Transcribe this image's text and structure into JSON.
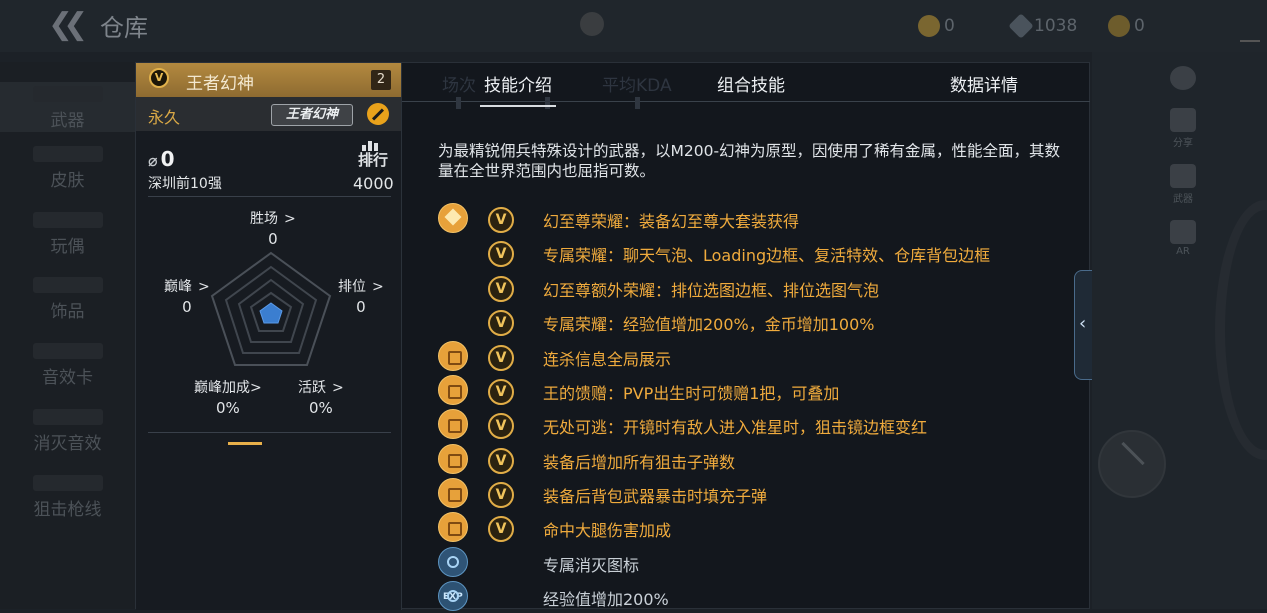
{
  "header": {
    "title": "仓库",
    "currencies": [
      {
        "icon": "gold-coin-icon",
        "value": "0"
      },
      {
        "icon": "diamond-icon",
        "value": "1038"
      },
      {
        "icon": "coupon-icon",
        "value": "0"
      }
    ]
  },
  "sidebar": {
    "items": [
      {
        "label": "武器"
      },
      {
        "label": "皮肤"
      },
      {
        "label": "玩偶"
      },
      {
        "label": "饰品"
      },
      {
        "label": "音效卡"
      },
      {
        "label": "消灭音效"
      },
      {
        "label": "狙击枪线"
      }
    ]
  },
  "right_toolbar": {
    "share_label": "分享",
    "weapon_label": "武器",
    "ar_label": "AR"
  },
  "popup": {
    "item_name": "王者幻神",
    "badge_letter": "V",
    "item_count": "2",
    "duration": "永久",
    "logo_text": "王者幻神",
    "kills": "0",
    "region_rank": "深圳前10强",
    "rank_label": "排行",
    "rank_value": "4000",
    "stats": {
      "wins_label": "胜场",
      "wins_value": "0",
      "peak_label": "巅峰",
      "peak_value": "0",
      "ranked_label": "排位",
      "ranked_value": "0",
      "peak_bonus_label": "巅峰加成",
      "peak_bonus_value": "0%",
      "activity_label": "活跃",
      "activity_value": "0%"
    },
    "ghost_tabs": [
      "场次",
      "",
      "平均KDA"
    ],
    "tabs": [
      {
        "label": "技能介绍",
        "active": true
      },
      {
        "label": "组合技能",
        "active": false
      },
      {
        "label": "数据详情",
        "active": false
      }
    ],
    "description": "为最精锐佣兵特殊设计的武器，以M200-幻神为原型，因使用了稀有金属，性能全面，其数量在全世界范围内也屈指可数。",
    "skills": [
      {
        "icon": "diamond-honor-icon",
        "text": "幻至尊荣耀：装备幻至尊大套装获得",
        "color": "orange"
      },
      {
        "icon": "",
        "text": "专属荣耀：聊天气泡、Loading边框、复活特效、仓库背包边框",
        "color": "orange"
      },
      {
        "icon": "",
        "text": "幻至尊额外荣耀：排位选图边框、排位选图气泡",
        "color": "orange"
      },
      {
        "icon": "",
        "text": "专属荣耀：经验值增加200%，金币增加100%",
        "color": "orange"
      },
      {
        "icon": "kill-banner-icon",
        "text": "连杀信息全局展示",
        "color": "orange"
      },
      {
        "icon": "gift-icon",
        "text": "王的馈赠：PVP出生时可馈赠1把，可叠加",
        "color": "orange"
      },
      {
        "icon": "scope-icon",
        "text": "无处可逃：开镜时有敌人进入准星时，狙击镜边框变红",
        "color": "orange"
      },
      {
        "icon": "ammo-icon",
        "text": "装备后增加所有狙击子弹数",
        "color": "orange"
      },
      {
        "icon": "critical-refill-icon",
        "text": "装备后背包武器暴击时填充子弹",
        "color": "orange"
      },
      {
        "icon": "leg-damage-icon",
        "text": "命中大腿伤害加成",
        "color": "orange"
      },
      {
        "icon": "kill-icon",
        "text": "专属消灭图标",
        "color": "plain"
      },
      {
        "icon": "exp-icon",
        "text": "经验值增加200%",
        "color": "plain",
        "icon_text": "EXP"
      }
    ]
  },
  "colors": {
    "accent_gold": "#e7a13a",
    "skill_text": "#f0ab3d",
    "plain_text": "#c9d0d7"
  }
}
